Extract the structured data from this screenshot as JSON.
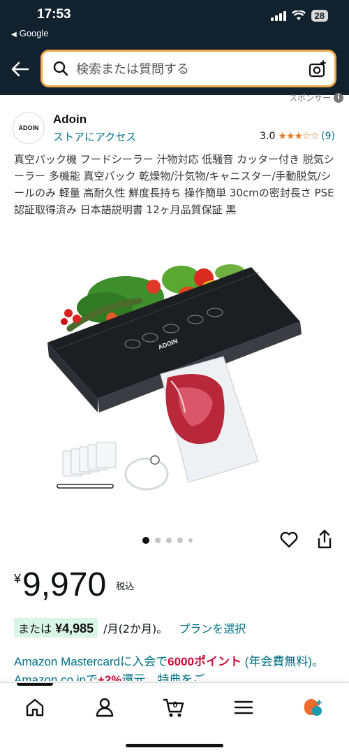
{
  "status_bar": {
    "time": "17:53",
    "back_app": "Google",
    "battery": "28"
  },
  "search": {
    "placeholder": "検索または質問する"
  },
  "sponsor_label": "スポンサー",
  "store": {
    "logo_text": "ADOIN",
    "name": "Adoin",
    "link": "ストアにアクセス",
    "rating_value": "3.0",
    "stars": "★★★☆☆",
    "rating_count": "(9)"
  },
  "product": {
    "title": "真空パック機 フードシーラー 汁物対応 低騒音 カッター付き 脱気シーラー 多機能 真空パック 乾燥物/汁気物/キャニスター/手動脱気/シールのみ 軽量 高耐久性 鮮度長持ち 操作簡単 30cmの密封長さ PSE認証取得済み 日本語説明書 12ヶ月品質保証 黒",
    "device_brand": "ADOIN",
    "image_count": 5,
    "active_image": 1
  },
  "price": {
    "currency": "¥",
    "value": "9,970",
    "tax_label": "税込"
  },
  "installment": {
    "prefix": "または",
    "amount": "¥4,985",
    "suffix": "/月(2か月)。",
    "plan_link": "プランを選択"
  },
  "promo": {
    "part1": "Amazon Mastercardに入会で",
    "highlight": "6000ポイント",
    "part2": " (年会費無料)。Amazon.co.jpで",
    "highlight2": "+2%",
    "part3": "還元、特典をご"
  },
  "nav": {
    "items": [
      "home-icon",
      "account-icon",
      "cart-icon",
      "menu-icon",
      "rufus-icon"
    ],
    "cart_count": "0"
  },
  "colors": {
    "header_bg": "#12212e",
    "search_border": "#f0a94a",
    "link": "#007185",
    "star": "#de7921",
    "promo_red": "#cc0c39",
    "install_bg": "#d9f5e6"
  }
}
